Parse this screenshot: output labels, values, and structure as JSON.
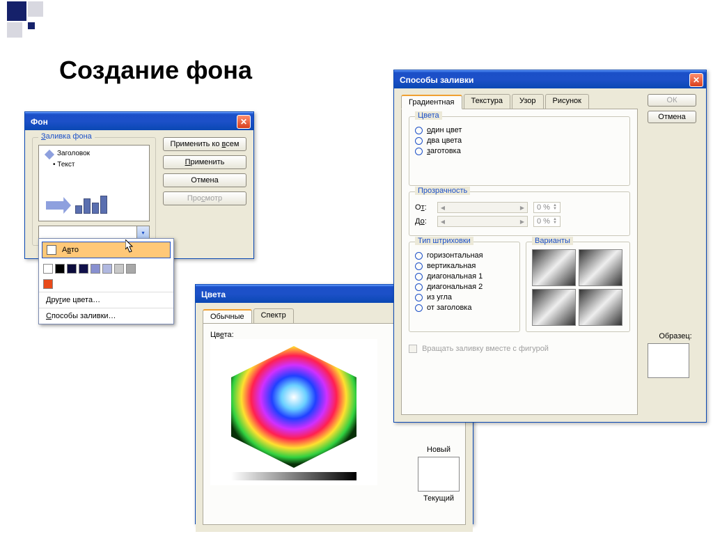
{
  "slide_title": "Создание фона",
  "dlg_background": {
    "title": "Фон",
    "group_label": "Заливка фона",
    "preview_header": "Заголовок",
    "preview_bullet": "• Текст",
    "btn_apply_all": "Применить ко всем",
    "btn_apply": "Применить",
    "btn_cancel": "Отмена",
    "btn_preview": "Просмотр"
  },
  "palette": {
    "auto_label": "Авто",
    "row1": [
      "#ffffff",
      "#000000",
      "#0b0b3b",
      "#10104a",
      "#8890d0",
      "#b0b8e0",
      "#c8c8c8",
      "#a8a8a8"
    ],
    "big_swatch": "#e84a1a",
    "more_colors": "Другие цвета…",
    "fill_effects": "Способы заливки…"
  },
  "dlg_colors": {
    "title": "Цвета",
    "tab_standard": "Обычные",
    "tab_spectrum": "Спектр",
    "label_colors": "Цвета:",
    "label_new": "Новый",
    "label_current": "Текущий"
  },
  "dlg_fill": {
    "title": "Способы заливки",
    "tabs": [
      "Градиентная",
      "Текстура",
      "Узор",
      "Рисунок"
    ],
    "btn_ok": "ОК",
    "btn_cancel": "Отмена",
    "group_colors": "Цвета",
    "radio_one": "один цвет",
    "radio_two": "два цвета",
    "radio_preset": "заготовка",
    "group_transparency": "Прозрачность",
    "label_from": "От:",
    "label_to": "До:",
    "pct": "0 %",
    "group_shading": "Тип штриховки",
    "shading": [
      "горизонтальная",
      "вертикальная",
      "диагональная 1",
      "диагональная 2",
      "из угла",
      "от заголовка"
    ],
    "group_variants": "Варианты",
    "label_sample": "Образец:",
    "rotate_label": "Вращать заливку вместе с фигурой"
  }
}
